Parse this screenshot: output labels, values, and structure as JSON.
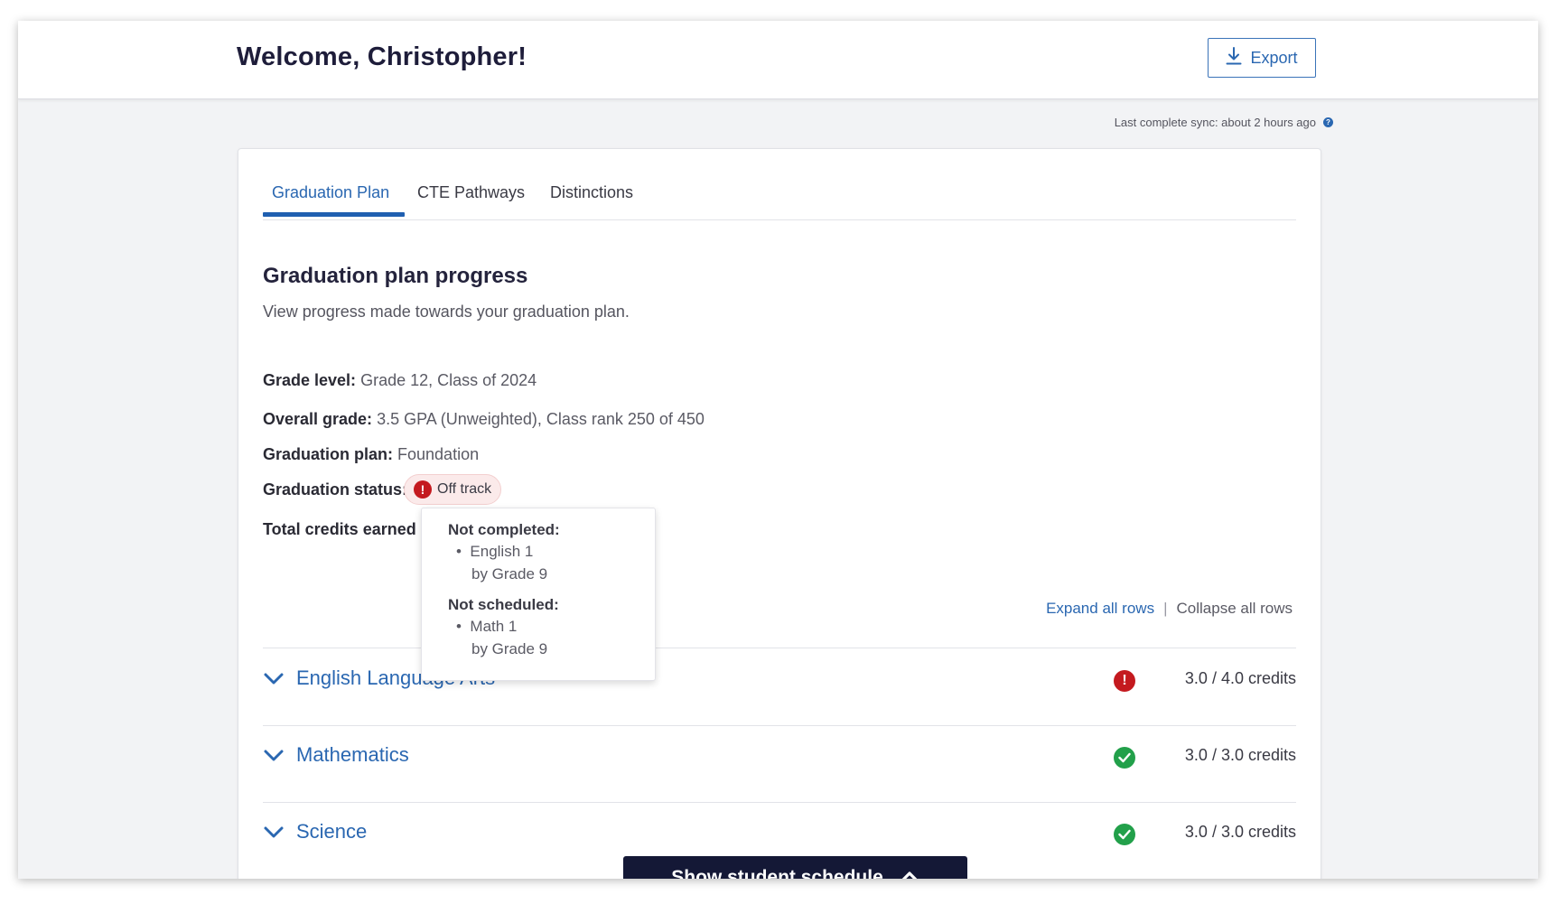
{
  "header": {
    "welcome": "Welcome, Christopher!",
    "export_label": "Export"
  },
  "sync": {
    "text": "Last complete sync: about 2 hours ago"
  },
  "tabs": [
    {
      "label": "Graduation Plan",
      "active": true
    },
    {
      "label": "CTE Pathways",
      "active": false
    },
    {
      "label": "Distinctions",
      "active": false
    }
  ],
  "section": {
    "title": "Graduation plan progress",
    "description": "View progress made towards your graduation plan."
  },
  "details": {
    "grade_level_label": "Grade level:",
    "grade_level_value": "Grade 12, Class of 2024",
    "overall_grade_label": "Overall grade:",
    "overall_grade_value": "3.5 GPA (Unweighted), Class rank 250 of 450",
    "plan_label": "Graduation plan:",
    "plan_value": "Foundation",
    "status_label": "Graduation status:",
    "status_value": "Off track",
    "credits_label": "Total credits earned"
  },
  "popover": {
    "not_completed_heading": "Not completed:",
    "not_completed_item": "English 1",
    "not_completed_sub": "by Grade 9",
    "not_scheduled_heading": "Not scheduled:",
    "not_scheduled_item": "Math 1",
    "not_scheduled_sub": "by Grade 9"
  },
  "row_controls": {
    "expand": "Expand all rows",
    "separator": "|",
    "collapse": "Collapse all rows"
  },
  "subjects": [
    {
      "name": "English Language Arts",
      "status": "error",
      "credits": "3.0 / 4.0 credits"
    },
    {
      "name": "Mathematics",
      "status": "complete",
      "credits": "3.0 / 3.0 credits"
    },
    {
      "name": "Science",
      "status": "complete",
      "credits": "3.0 / 3.0 credits"
    }
  ],
  "schedule_button": {
    "label": "Show student schedule"
  },
  "colors": {
    "accent": "#2a67b1",
    "error": "#c41a1f",
    "success": "#22a04a",
    "dark_button": "#141836"
  }
}
